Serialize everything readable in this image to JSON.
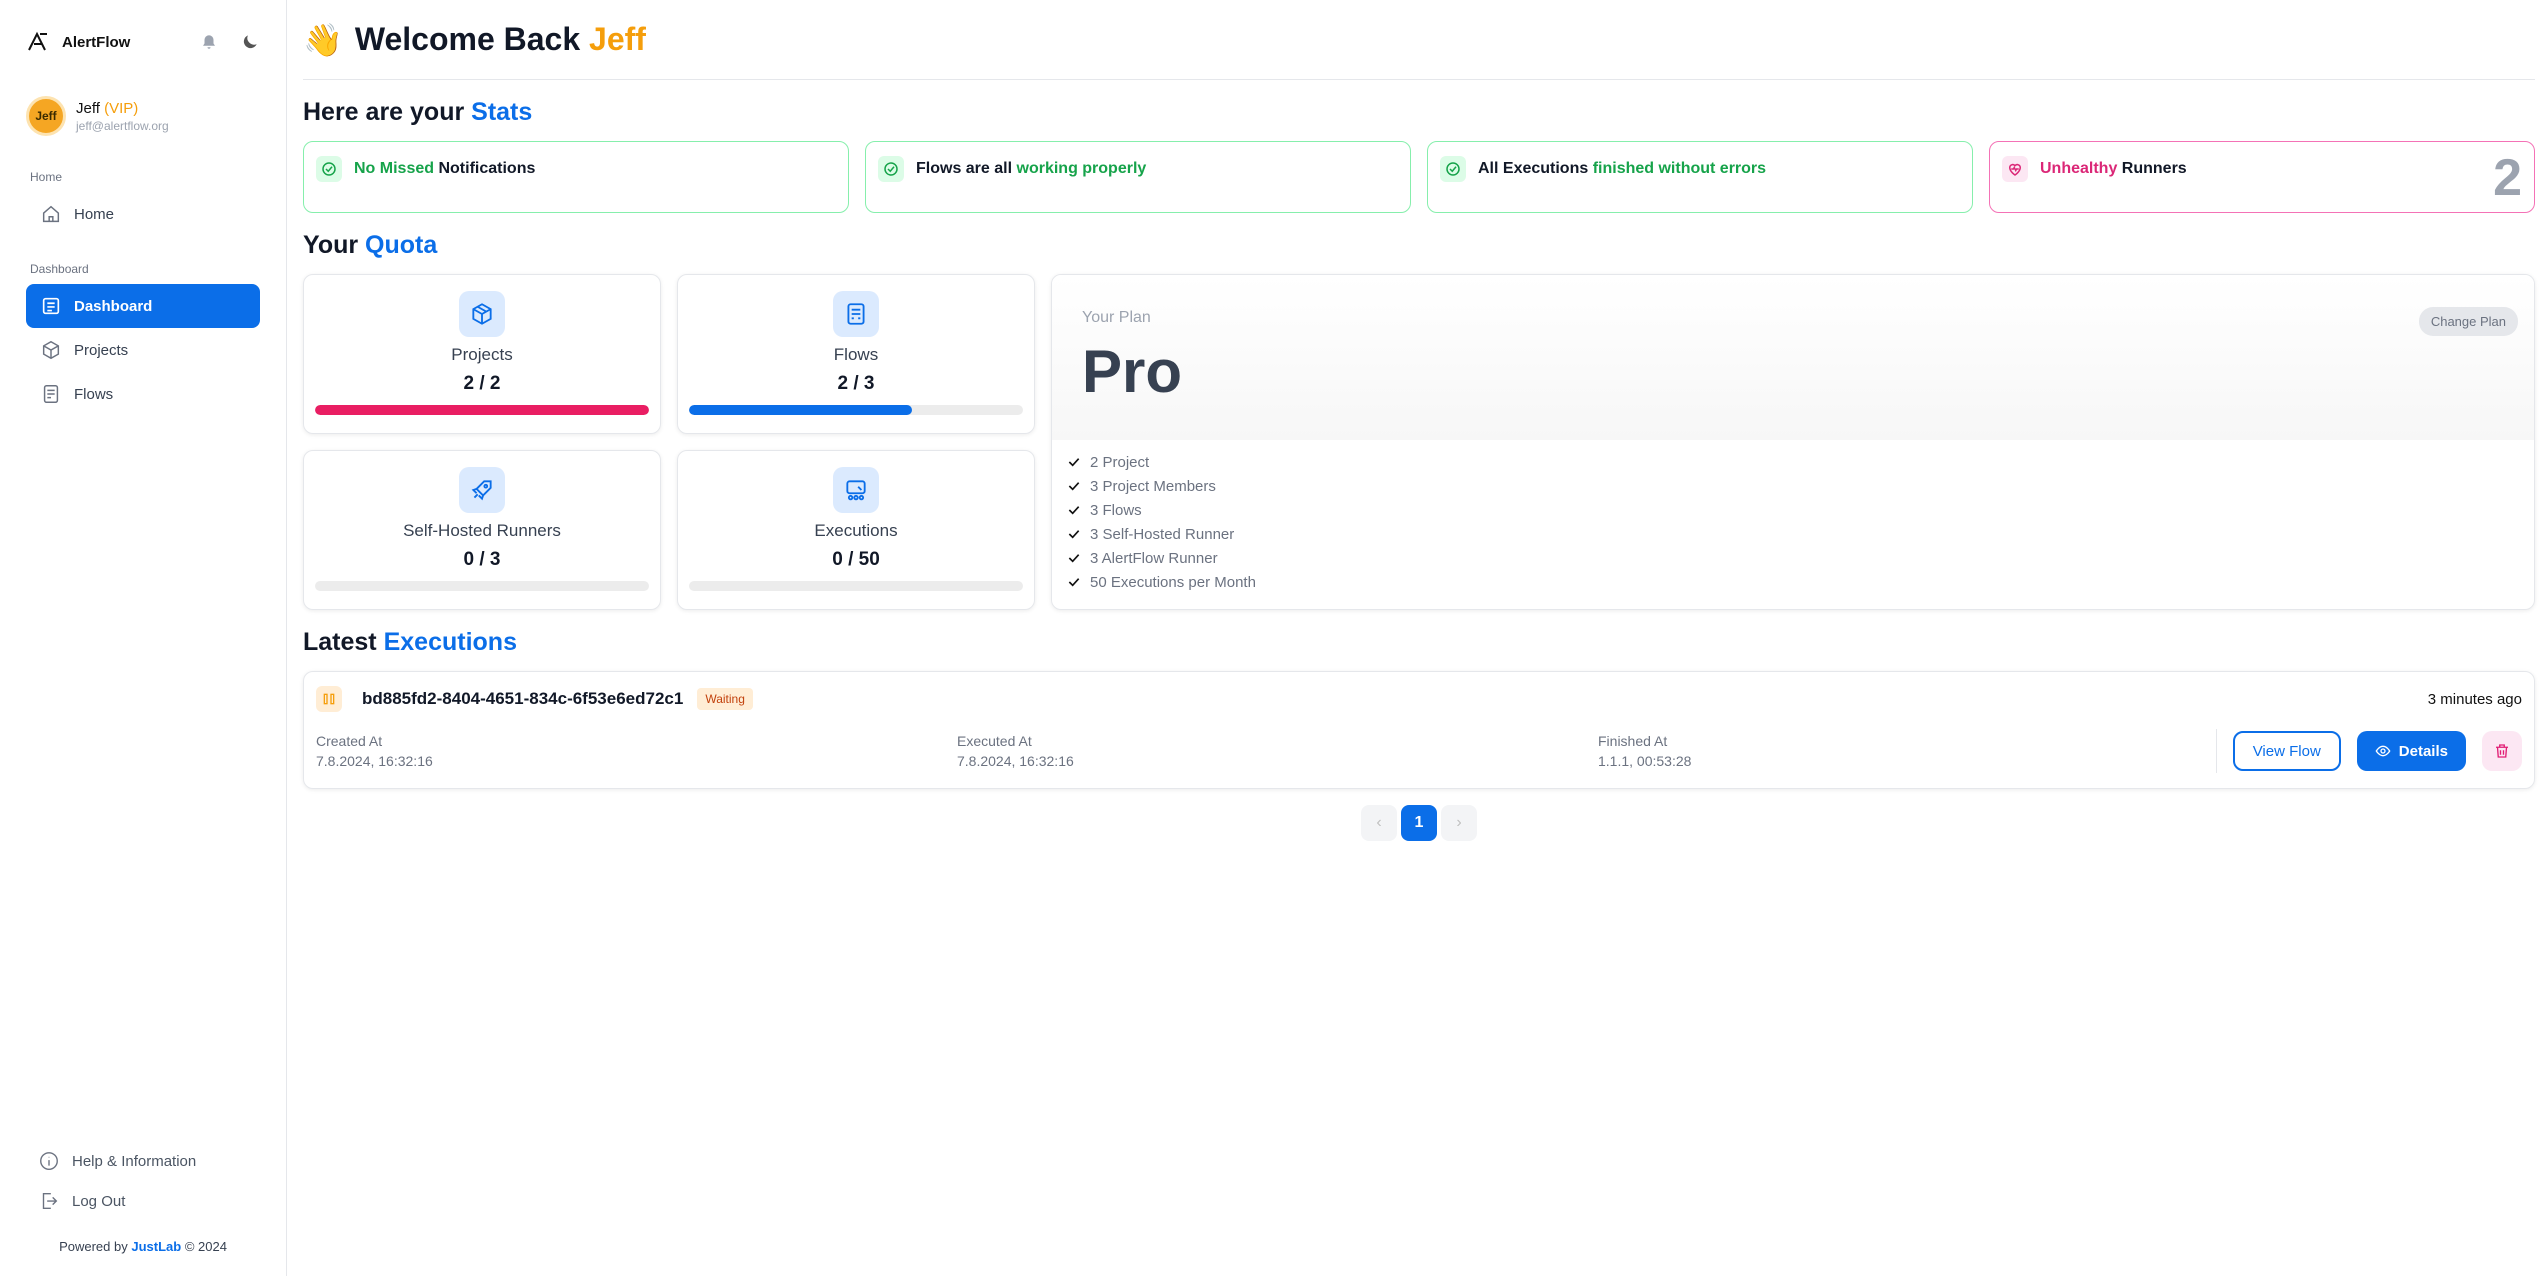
{
  "app": {
    "name": "AlertFlow"
  },
  "user": {
    "initial": "Jeff",
    "name": "Jeff",
    "tier": "(VIP)",
    "email": "jeff@alertflow.org"
  },
  "nav": {
    "section_home": "Home",
    "home": "Home",
    "section_dashboard": "Dashboard",
    "dashboard": "Dashboard",
    "projects": "Projects",
    "flows": "Flows"
  },
  "footer": {
    "help": "Help & Information",
    "logout": "Log Out",
    "powered_prefix": "Powered by",
    "powered_brand": "JustLab",
    "powered_suffix": "© 2024"
  },
  "welcome": {
    "emoji": "👋",
    "prefix": "Welcome Back",
    "name": "Jeff"
  },
  "stats": {
    "title_prefix": "Here are your",
    "title_accent": "Stats",
    "cards": [
      {
        "a": "No Missed",
        "b": "Notifications"
      },
      {
        "a": "Flows are all",
        "b": "working properly"
      },
      {
        "a": "All Executions",
        "b": "finished without errors"
      },
      {
        "a": "Unhealthy",
        "b": "Runners",
        "count": "2"
      }
    ]
  },
  "quota": {
    "title_prefix": "Your",
    "title_accent": "Quota",
    "items": [
      {
        "label": "Projects",
        "value": "2 / 2",
        "progress": 1.0,
        "color": "#e91e63"
      },
      {
        "label": "Flows",
        "value": "2 / 3",
        "progress": 0.667,
        "color": "#0b6ee8"
      },
      {
        "label": "Self-Hosted Runners",
        "value": "0 / 3",
        "progress": 0,
        "color": "#0b6ee8"
      },
      {
        "label": "Executions",
        "value": "0 / 50",
        "progress": 0,
        "color": "#0b6ee8"
      }
    ]
  },
  "plan": {
    "eyebrow": "Your Plan",
    "name": "Pro",
    "change_label": "Change Plan",
    "features": [
      "2 Project",
      "3 Project Members",
      "3 Flows",
      "3 Self-Hosted Runner",
      "3 AlertFlow Runner",
      "50 Executions per Month"
    ]
  },
  "executions": {
    "title_prefix": "Latest",
    "title_accent": "Executions",
    "items": [
      {
        "id": "bd885fd2-8404-4651-834c-6f53e6ed72c1",
        "status": "Waiting",
        "ago": "3 minutes ago",
        "created_label": "Created At",
        "created": "7.8.2024, 16:32:16",
        "executed_label": "Executed At",
        "executed": "7.8.2024, 16:32:16",
        "finished_label": "Finished At",
        "finished": "1.1.1, 00:53:28",
        "view_label": "View Flow",
        "details_label": "Details"
      }
    ]
  },
  "pagination": {
    "prev": "‹",
    "current": "1",
    "next": "›"
  }
}
